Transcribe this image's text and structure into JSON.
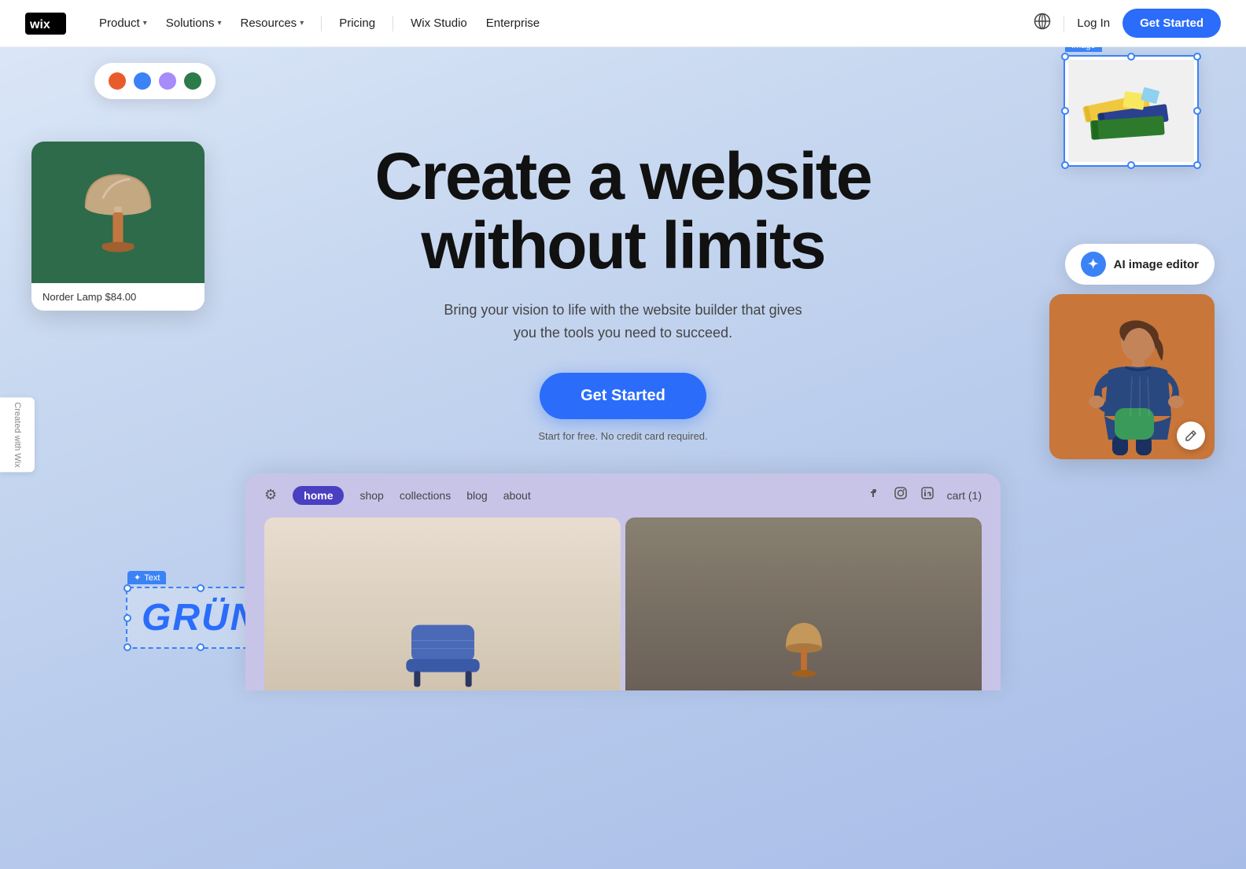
{
  "navbar": {
    "logo_alt": "Wix",
    "nav_items": [
      {
        "label": "Product",
        "has_dropdown": true
      },
      {
        "label": "Solutions",
        "has_dropdown": true
      },
      {
        "label": "Resources",
        "has_dropdown": true
      }
    ],
    "nav_plain_items": [
      {
        "label": "Pricing"
      },
      {
        "label": "Wix Studio"
      },
      {
        "label": "Enterprise"
      }
    ],
    "login_label": "Log In",
    "get_started_label": "Get Started"
  },
  "hero": {
    "title_line1": "Create a website",
    "title_line2": "without limits",
    "subtitle": "Bring your vision to life with the website builder that gives you the tools you need to succeed.",
    "cta_label": "Get Started",
    "free_text": "Start for free. No credit card required.",
    "color_dots": [
      "#e85c2c",
      "#3b82f6",
      "#a78bfa",
      "#2d7a4a"
    ],
    "lamp_label": "Norder Lamp $84.00",
    "text_widget_label": "Text",
    "grun_text": "GRÜN",
    "image_widget_label": "Image",
    "ai_badge_label": "AI image editor"
  },
  "preview": {
    "nav_items": [
      "home",
      "shop",
      "collections",
      "blog",
      "about"
    ],
    "active_nav": "home",
    "cart_label": "cart (1)"
  },
  "side_tab": {
    "label": "Created with Wix"
  }
}
